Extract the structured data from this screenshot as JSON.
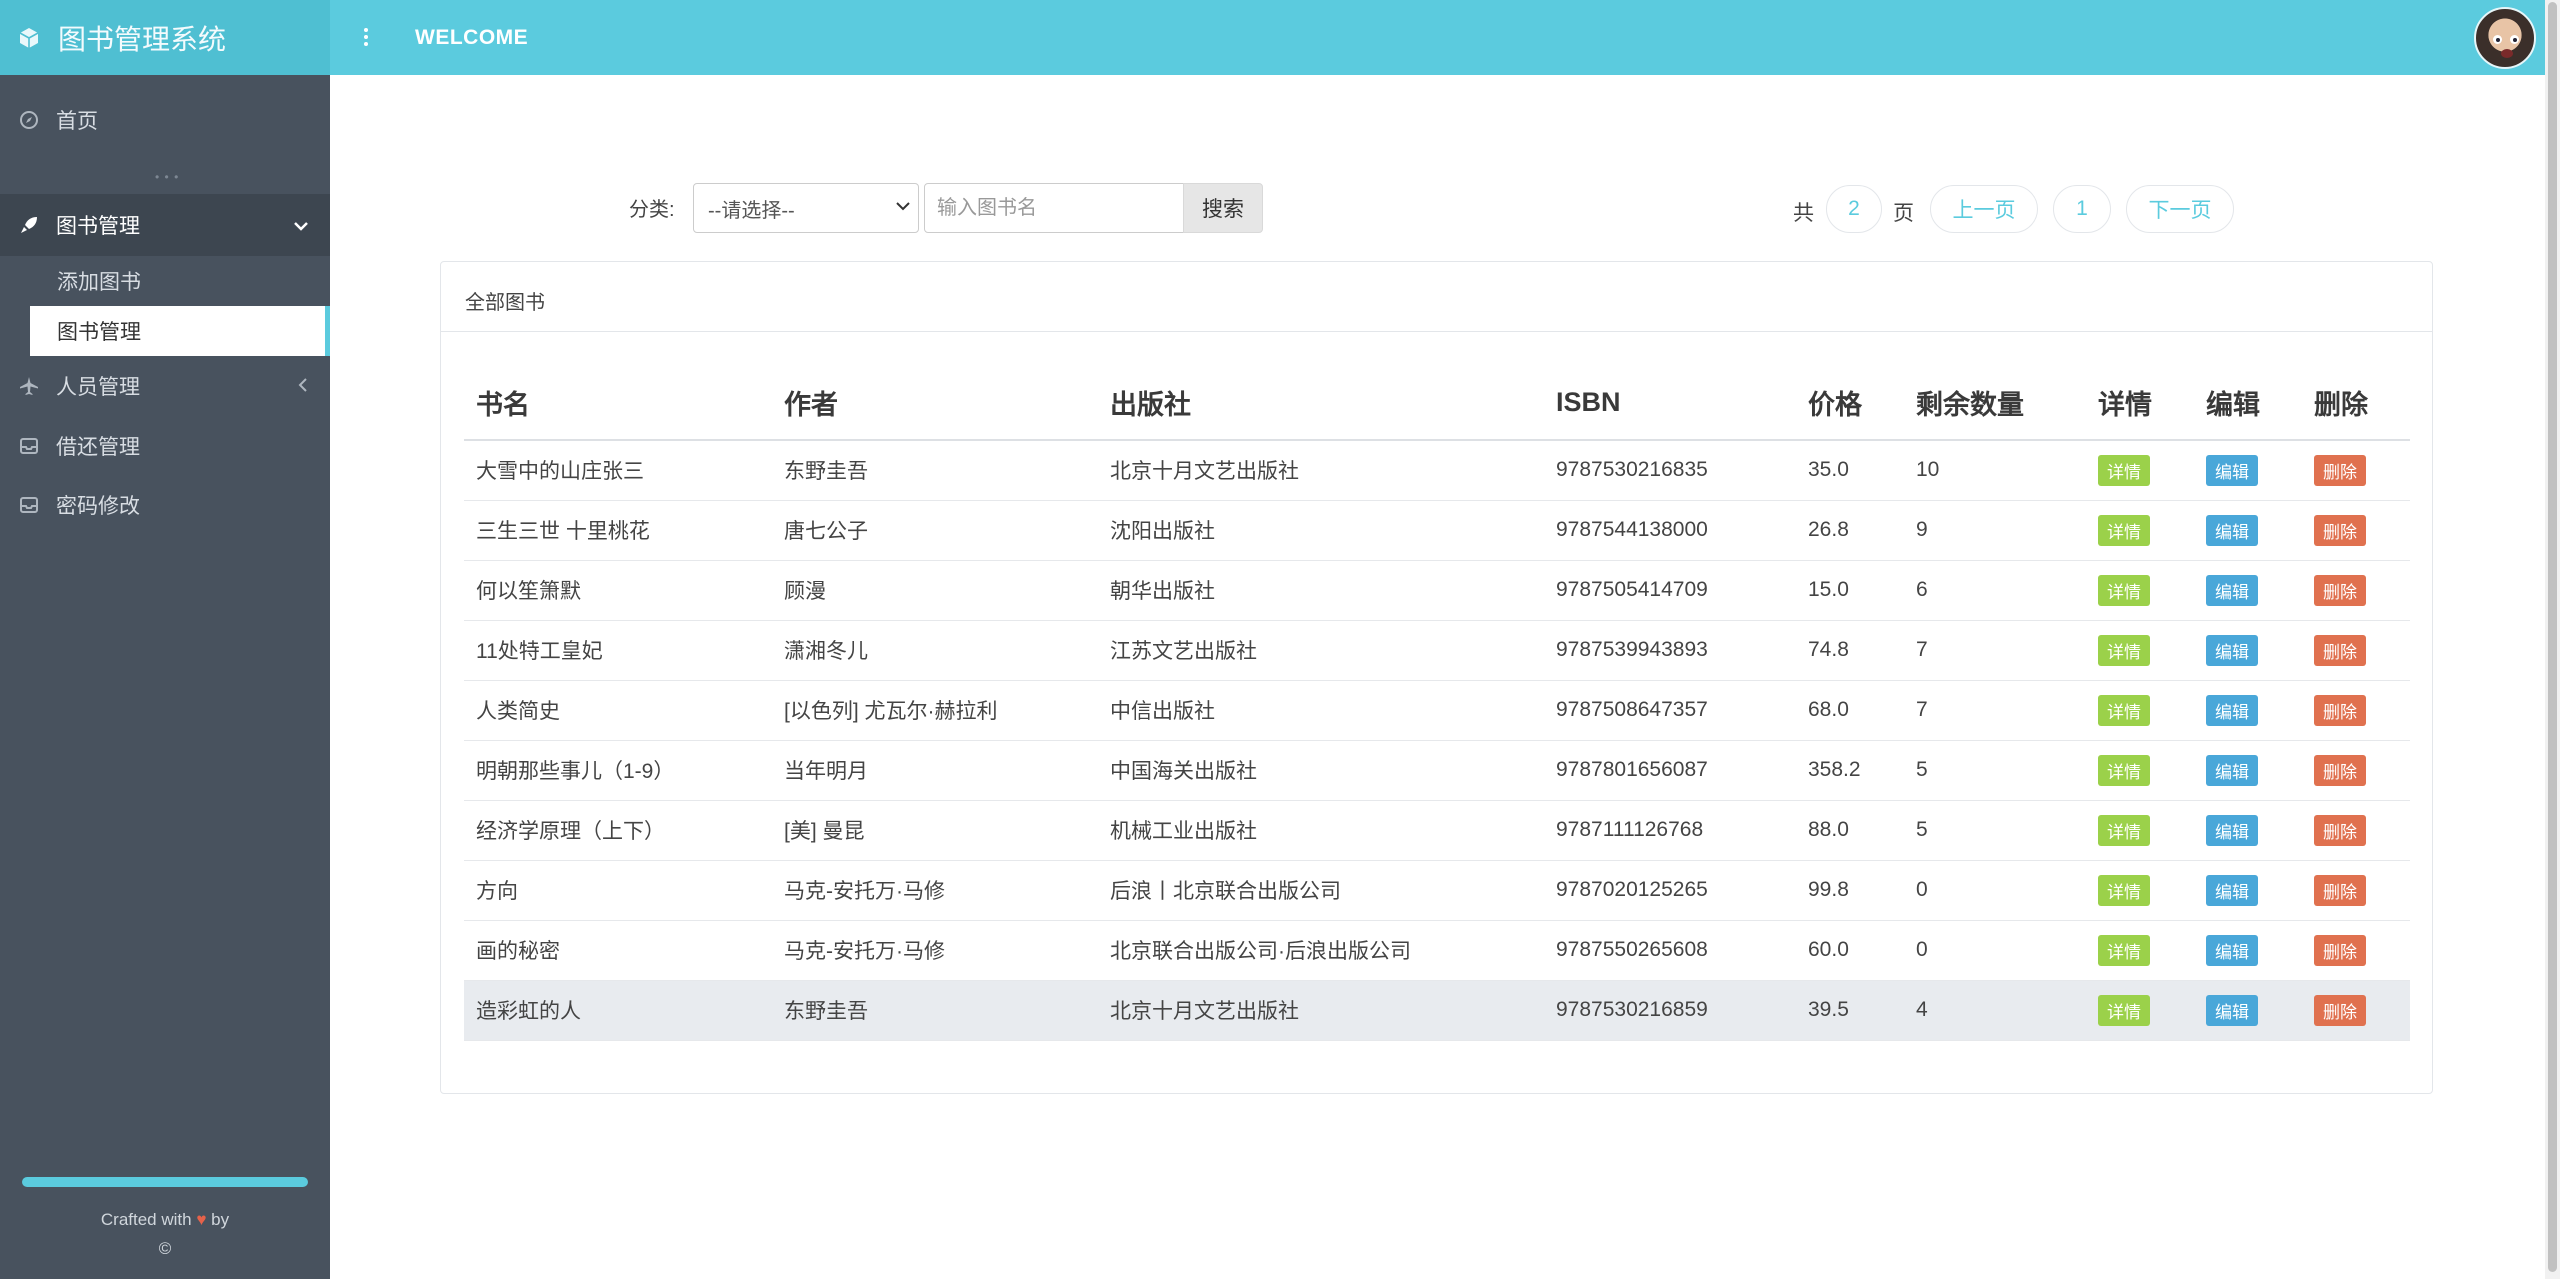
{
  "app": {
    "title": "图书管理系统",
    "welcome": "WELCOME"
  },
  "sidebar": {
    "home": "首页",
    "books": "图书管理",
    "books_sub": [
      "添加图书",
      "图书管理"
    ],
    "users": "人员管理",
    "borrow": "借还管理",
    "password": "密码修改",
    "footer_crafted": "Crafted with",
    "footer_by": "by",
    "footer_copy": "©",
    "progress_fraction": 1.0
  },
  "search": {
    "category_label": "分类:",
    "category_selected": "--请选择--",
    "input_placeholder": "输入图书名",
    "button": "搜索"
  },
  "pagination": {
    "prefix": "共",
    "total_pages": "2",
    "suffix": "页",
    "prev": "上一页",
    "current": "1",
    "next": "下一页"
  },
  "panel": {
    "title": "全部图书"
  },
  "table": {
    "headers": [
      "书名",
      "作者",
      "出版社",
      "ISBN",
      "价格",
      "剩余数量",
      "详情",
      "编辑",
      "删除"
    ],
    "action_labels": {
      "detail": "详情",
      "edit": "编辑",
      "delete": "删除"
    },
    "rows": [
      [
        "大雪中的山庄张三",
        "东野圭吾",
        "北京十月文艺出版社",
        "9787530216835",
        "35.0",
        "10"
      ],
      [
        "三生三世 十里桃花",
        "唐七公子",
        "沈阳出版社",
        "9787544138000",
        "26.8",
        "9"
      ],
      [
        "何以笙箫默",
        "顾漫",
        "朝华出版社",
        "9787505414709",
        "15.0",
        "6"
      ],
      [
        "11处特工皇妃",
        "潇湘冬儿",
        "江苏文艺出版社",
        "9787539943893",
        "74.8",
        "7"
      ],
      [
        "人类简史",
        "[以色列] 尤瓦尔·赫拉利",
        "中信出版社",
        "9787508647357",
        "68.0",
        "7"
      ],
      [
        "明朝那些事儿（1-9）",
        "当年明月",
        "中国海关出版社",
        "9787801656087",
        "358.2",
        "5"
      ],
      [
        "经济学原理（上下）",
        "[美] 曼昆",
        "机械工业出版社",
        "9787111126768",
        "88.0",
        "5"
      ],
      [
        "方向",
        "马克-安托万·马修",
        "后浪丨北京联合出版公司",
        "9787020125265",
        "99.8",
        "0"
      ],
      [
        "画的秘密",
        "马克-安托万·马修",
        "北京联合出版公司·后浪出版公司",
        "9787550265608",
        "60.0",
        "0"
      ],
      [
        "造彩虹的人",
        "东野圭吾",
        "北京十月文艺出版社",
        "9787530216859",
        "39.5",
        "4"
      ]
    ],
    "highlighted_row": 9
  },
  "colors": {
    "header": "#5bcbde",
    "sidebar": "#48525e",
    "detail": "#9bd14a",
    "edit": "#49a7d9",
    "delete": "#e0714f"
  }
}
